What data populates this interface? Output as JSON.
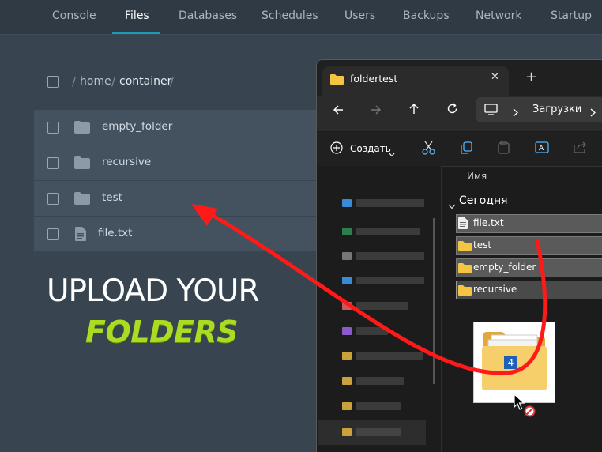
{
  "nav": {
    "tabs": [
      {
        "label": "Console"
      },
      {
        "label": "Files"
      },
      {
        "label": "Databases"
      },
      {
        "label": "Schedules"
      },
      {
        "label": "Users"
      },
      {
        "label": "Backups"
      },
      {
        "label": "Network"
      },
      {
        "label": "Startup"
      }
    ],
    "active": "Files"
  },
  "breadcrumb": {
    "sep": "/",
    "parts": [
      "home",
      "container"
    ]
  },
  "files": [
    {
      "name": "empty_folder",
      "type": "folder"
    },
    {
      "name": "recursive",
      "type": "folder"
    },
    {
      "name": "test",
      "type": "folder"
    },
    {
      "name": "file.txt",
      "type": "file"
    }
  ],
  "promo": {
    "line1": "UPLOAD YOUR",
    "line2": "FOLDERS"
  },
  "explorer": {
    "tab_title": "foldertest",
    "close_glyph": "✕",
    "new_tab_glyph": "+",
    "address": "Загрузки",
    "create_label": "Создать",
    "column_name": "Имя",
    "group_label": "Сегодня",
    "items": [
      {
        "name": "file.txt",
        "type": "file"
      },
      {
        "name": "test",
        "type": "folder"
      },
      {
        "name": "empty_folder",
        "type": "folder"
      },
      {
        "name": "recursive",
        "type": "folder"
      }
    ],
    "drag_count": "4"
  },
  "colors": {
    "accent": "#1d9bb5",
    "promo_green": "#aadd22",
    "arrow_red": "#ff1a1a",
    "folder_yellow": "#f4c542"
  }
}
